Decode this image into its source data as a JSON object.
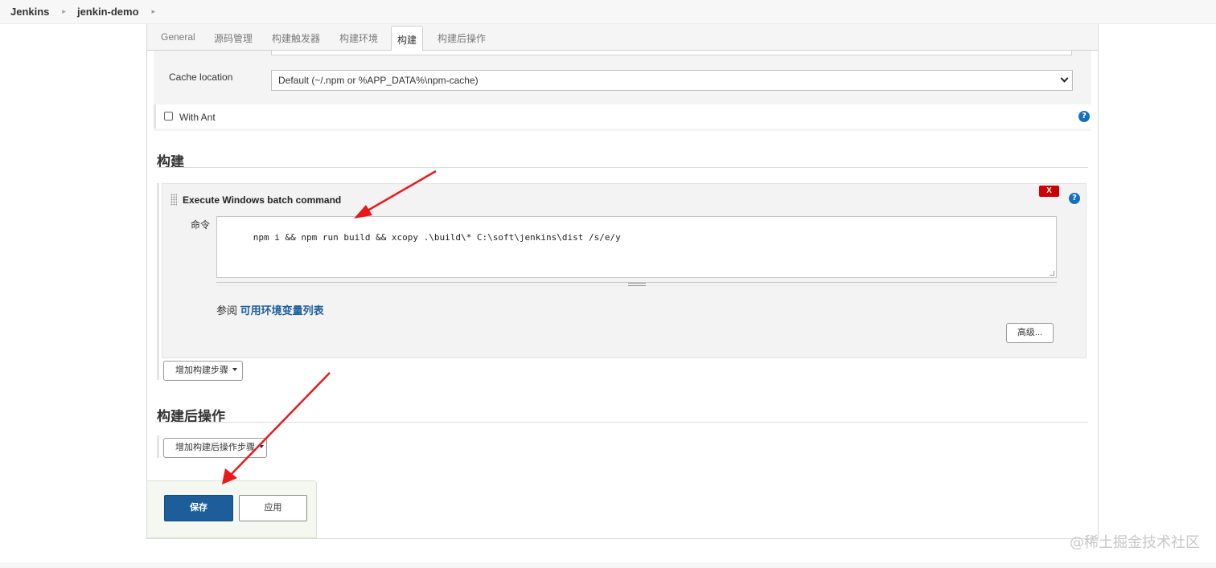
{
  "breadcrumb": {
    "items": [
      "Jenkins",
      "jenkin-demo"
    ]
  },
  "tabs": [
    {
      "label": "General",
      "active": false
    },
    {
      "label": "源码管理",
      "active": false
    },
    {
      "label": "构建触发器",
      "active": false
    },
    {
      "label": "构建环境",
      "active": false
    },
    {
      "label": "构建",
      "active": true
    },
    {
      "label": "构建后操作",
      "active": false
    }
  ],
  "build_env": {
    "cache_location_label": "Cache location",
    "cache_location_value": "Default (~/.npm or %APP_DATA%\\npm-cache)",
    "with_ant_label": "With Ant",
    "with_ant_checked": false
  },
  "help_icon_glyph": "?",
  "build_section": {
    "heading": "构建",
    "step": {
      "title": "Execute Windows batch command",
      "delete_label": "X",
      "command_label": "命令",
      "command_value": "npm i && npm run build && xcopy .\\build\\* C:\\soft\\jenkins\\dist /s/e/y",
      "env_prefix": "参阅",
      "env_link": "可用环境变量列表",
      "advanced_label": "高级..."
    },
    "add_step_label": "增加构建步骤"
  },
  "post_build_section": {
    "heading": "构建后操作",
    "add_step_label": "增加构建后操作步骤"
  },
  "actions": {
    "save_label": "保存",
    "apply_label": "应用"
  },
  "watermark": "@稀土掘金技术社区",
  "colors": {
    "primary": "#1d5d99",
    "delete": "#cc0000",
    "help": "#1471bd",
    "annotation_arrow": "#e8191a"
  }
}
